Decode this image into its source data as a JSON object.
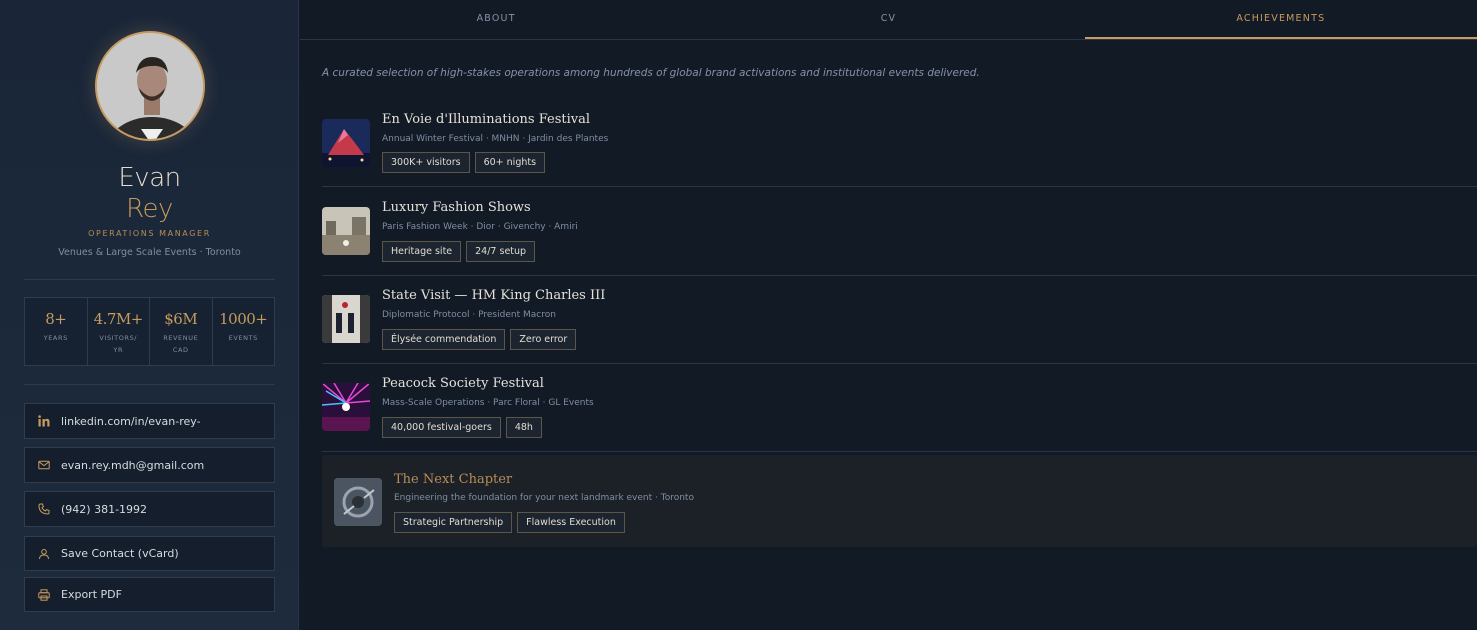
{
  "profile": {
    "first_name": "Evan",
    "last_name": "Rey",
    "role": "OPERATIONS MANAGER",
    "location": "Venues & Large Scale Events · Toronto"
  },
  "stats": [
    {
      "value": "8+",
      "label": "YEARS"
    },
    {
      "value": "4.7M+",
      "label": "VISITORS/ YR"
    },
    {
      "value": "$6M",
      "label": "REVENUE CAD"
    },
    {
      "value": "1000+",
      "label": "EVENTS"
    }
  ],
  "contacts": [
    {
      "icon": "linkedin-icon",
      "label": "linkedin.com/in/evan-rey-"
    },
    {
      "icon": "mail-icon",
      "label": "evan.rey.mdh@gmail.com"
    },
    {
      "icon": "phone-icon",
      "label": "(942) 381-1992"
    },
    {
      "icon": "user-icon",
      "label": "Save Contact (vCard)"
    },
    {
      "icon": "printer-icon",
      "label": "Export PDF"
    }
  ],
  "tabs": [
    {
      "label": "ABOUT",
      "active": false
    },
    {
      "label": "CV",
      "active": false
    },
    {
      "label": "ACHIEVEMENTS",
      "active": true
    }
  ],
  "intro": "A curated selection of high-stakes operations among hundreds of global brand activations and institutional events delivered.",
  "achievements": [
    {
      "title": "En Voie d'Illuminations Festival",
      "subtitle": "Annual Winter Festival · MNHN · Jardin des Plantes",
      "tags": [
        "300K+ visitors",
        "60+ nights"
      ]
    },
    {
      "title": "Luxury Fashion Shows",
      "subtitle": "Paris Fashion Week · Dior · Givenchy · Amiri",
      "tags": [
        "Heritage site",
        "24/7 setup"
      ]
    },
    {
      "title": "State Visit — HM King Charles III",
      "subtitle": "Diplomatic Protocol · President Macron",
      "tags": [
        "Élysée commendation",
        "Zero error"
      ]
    },
    {
      "title": "Peacock Society Festival",
      "subtitle": "Mass-Scale Operations · Parc Floral · GL Events",
      "tags": [
        "40,000 festival-goers",
        "48h"
      ]
    }
  ],
  "next_chapter": {
    "title": "The Next Chapter",
    "subtitle": "Engineering the foundation for your next landmark event · Toronto",
    "tags": [
      "Strategic Partnership",
      "Flawless Execution"
    ]
  },
  "colors": {
    "accent": "#c79a5e",
    "background": "#121a26",
    "sidebar": "#1b283a"
  }
}
